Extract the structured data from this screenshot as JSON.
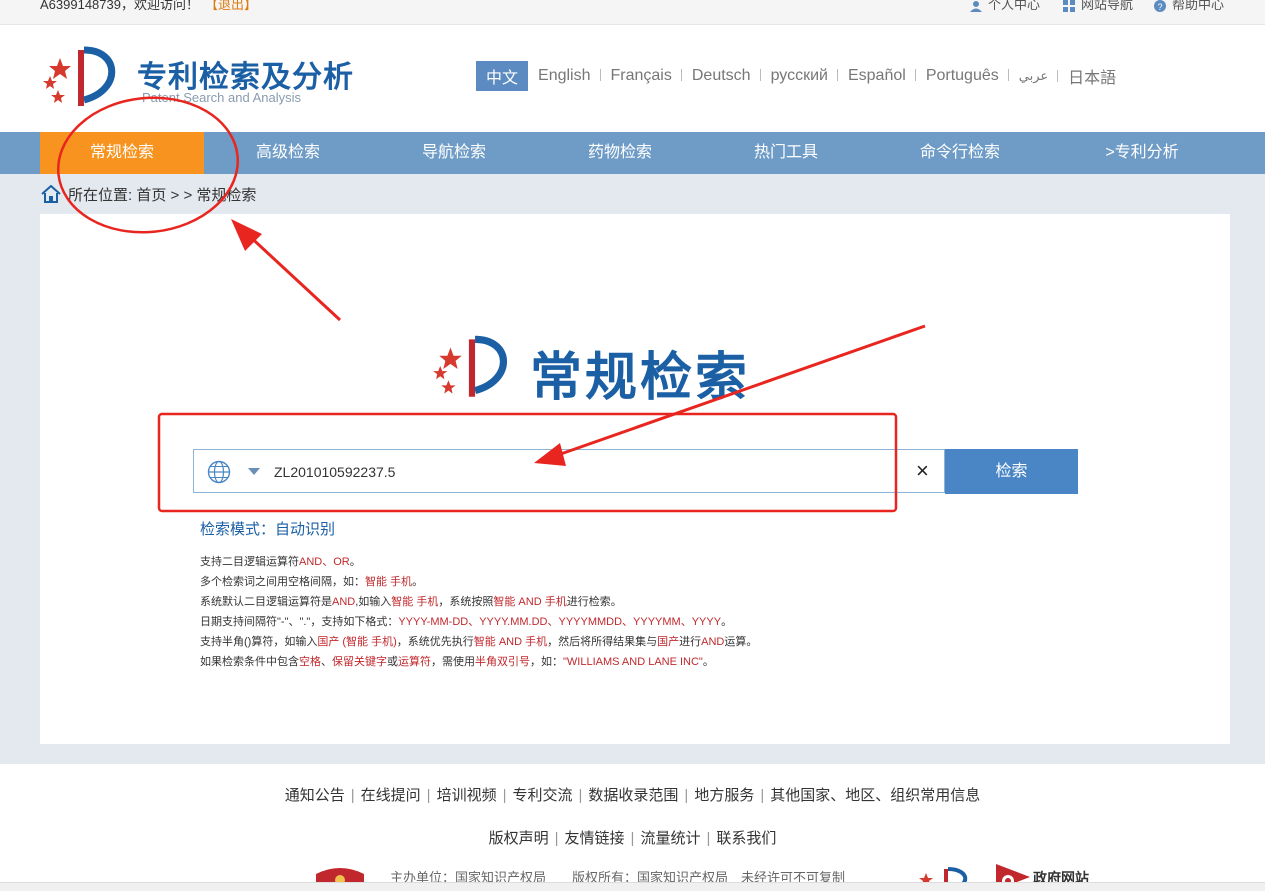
{
  "topbar": {
    "welcome": "A6399148739，欢迎访问！",
    "logout": "【退出】",
    "links": [
      "个人中心",
      "网站导航",
      "帮助中心"
    ]
  },
  "header": {
    "title": "专利检索及分析",
    "subtitle": "Patent Search and Analysis",
    "languages": [
      "中文",
      "English",
      "Français",
      "Deutsch",
      "русский",
      "Español",
      "Português",
      "عربي",
      "日本語"
    ],
    "active_language": "中文"
  },
  "nav": {
    "items": [
      "常规检索",
      "高级检索",
      "导航检索",
      "药物检索",
      "热门工具",
      "命令行检索",
      ">专利分析"
    ],
    "active": "常规检索"
  },
  "breadcrumb": {
    "prefix": "所在位置:",
    "home": "首页",
    "sep": "> >",
    "current": "常规检索"
  },
  "main": {
    "title": "常规检索",
    "search": {
      "value": "ZL201010592237.5",
      "clear": "×",
      "button": "检索"
    },
    "mode": "检索模式：自动识别",
    "help": [
      [
        {
          "t": "支持二目逻辑运算符"
        },
        {
          "t": "AND、OR",
          "r": true
        },
        {
          "t": "。"
        }
      ],
      [
        {
          "t": "多个检索词之间用空格间隔，如："
        },
        {
          "t": "智能 手机",
          "r": true
        },
        {
          "t": "。"
        }
      ],
      [
        {
          "t": "系统默认二目逻辑运算符是"
        },
        {
          "t": "AND",
          "r": true
        },
        {
          "t": ",如输入"
        },
        {
          "t": "智能 手机",
          "r": true
        },
        {
          "t": "，系统按照"
        },
        {
          "t": "智能 AND 手机",
          "r": true
        },
        {
          "t": "进行检索。"
        }
      ],
      [
        {
          "t": "日期支持间隔符\"-\"、\".\"，支持如下格式："
        },
        {
          "t": "YYYY-MM-DD、YYYY.MM.DD、YYYYMMDD、YYYYMM、YYYY",
          "r": true
        },
        {
          "t": "。"
        }
      ],
      [
        {
          "t": "支持半角()算符，如输入"
        },
        {
          "t": "国产 (智能 手机)",
          "r": true
        },
        {
          "t": "，系统优先执行"
        },
        {
          "t": "智能 AND 手机",
          "r": true
        },
        {
          "t": "，然后将所得结果集与"
        },
        {
          "t": "国产",
          "r": true
        },
        {
          "t": "进行"
        },
        {
          "t": "AND",
          "r": true
        },
        {
          "t": "运算。"
        }
      ],
      [
        {
          "t": "如果检索条件中包含"
        },
        {
          "t": "空格",
          "r": true
        },
        {
          "t": "、"
        },
        {
          "t": "保留关键字",
          "r": true
        },
        {
          "t": "或"
        },
        {
          "t": "运算符",
          "r": true
        },
        {
          "t": "，需使用"
        },
        {
          "t": "半角双引号",
          "r": true
        },
        {
          "t": "，如："
        },
        {
          "t": "\"WILLIAMS AND LANE INC\"",
          "r": true
        },
        {
          "t": "。"
        }
      ]
    ]
  },
  "footer": {
    "links1": [
      "通知公告",
      "在线提问",
      "培训视频",
      "专利交流",
      "数据收录范围",
      "地方服务",
      "其他国家、地区、组织常用信息"
    ],
    "links2": [
      "版权声明",
      "友情链接",
      "流量统计",
      "联系我们"
    ],
    "info": "主办单位：国家知识产权局　　版权所有：国家知识产权局　未经许可不可复制",
    "gov": "政府网站"
  },
  "colors": {
    "brand_blue": "#1b5fa5",
    "nav_bg": "#6f9cc6",
    "nav_active": "#f7931e",
    "button_blue": "#4a86c5",
    "annotation_red": "#e8261f"
  }
}
